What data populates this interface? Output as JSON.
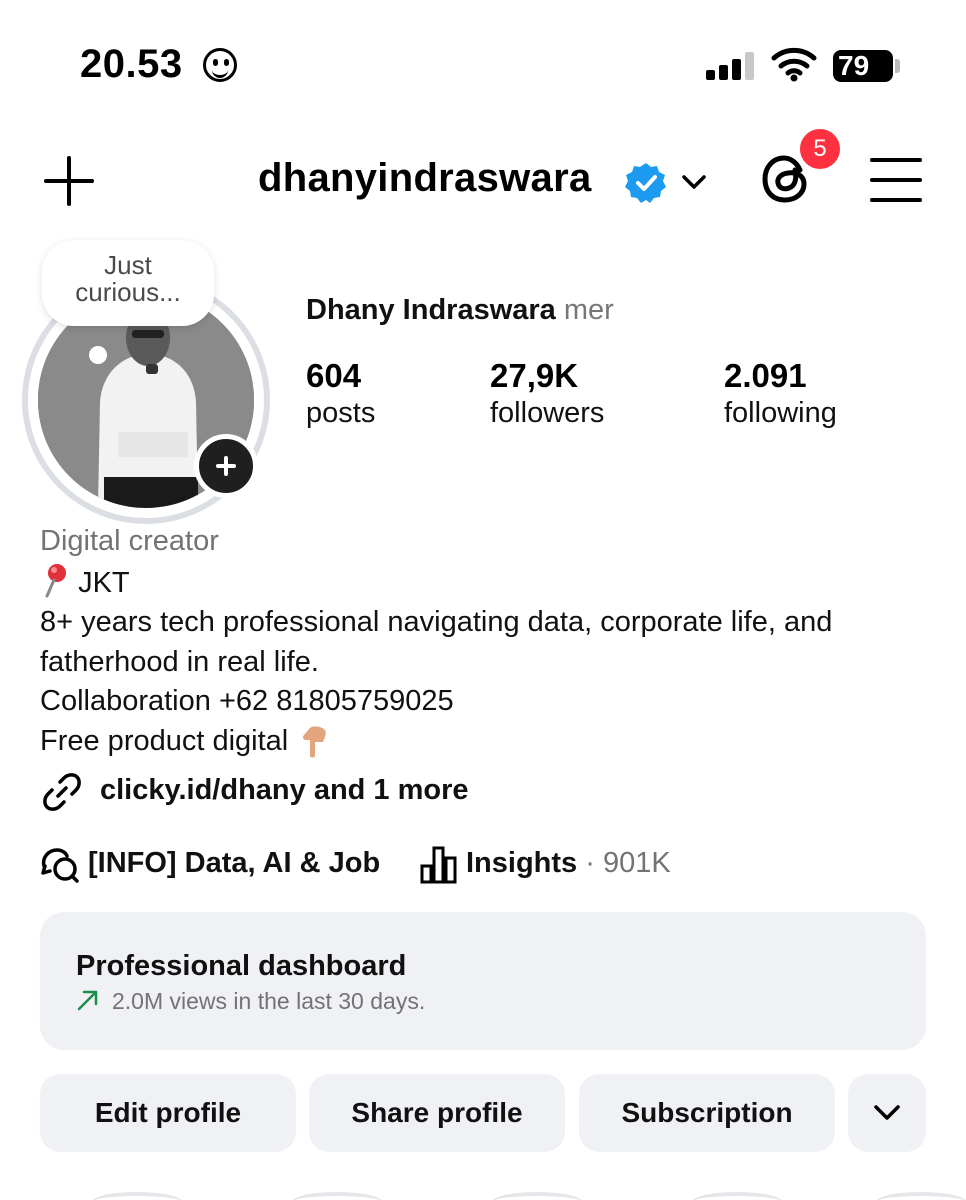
{
  "status_bar": {
    "time": "20.53",
    "battery": "79"
  },
  "header": {
    "username": "dhanyindraswara",
    "notification_count": "5"
  },
  "profile": {
    "note": "Just curious...",
    "display_name": "Dhany Indraswara",
    "pronouns": "mer",
    "stats": {
      "posts": {
        "value": "604",
        "label": "posts"
      },
      "followers": {
        "value": "27,9K",
        "label": "followers"
      },
      "following": {
        "value": "2.091",
        "label": "following"
      }
    },
    "category": "Digital creator",
    "location": "JKT",
    "bio_line1": "8+ years tech professional navigating data, corporate life, and fatherhood in real life.",
    "bio_line2": "Collaboration +62 81805759025",
    "bio_line3": "Free product digital",
    "link": "clicky.id/dhany and 1 more",
    "channel": "[INFO] Data, AI & Job",
    "insights_label": "Insights",
    "insights_count": "· 901K"
  },
  "dashboard": {
    "title": "Professional dashboard",
    "subtitle": "2.0M views in the last 30 days.",
    "accent": "#1a8f4c"
  },
  "buttons": {
    "edit": "Edit profile",
    "share": "Share profile",
    "subscription": "Subscription"
  },
  "colors": {
    "badge": "#ff3040",
    "verified": "#1d9bf0",
    "button_bg": "#eff1f4",
    "secondary_text": "#737373"
  }
}
